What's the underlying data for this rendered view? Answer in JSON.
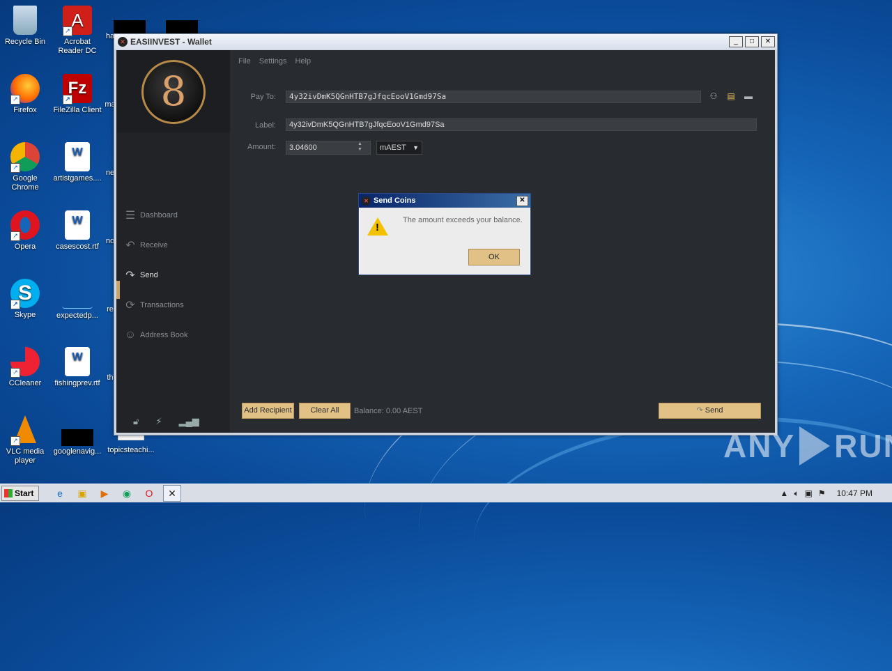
{
  "desktop": {
    "icons": [
      {
        "label": "Recycle Bin"
      },
      {
        "label": "Acrobat Reader DC"
      },
      {
        "label": "ha"
      },
      {
        "label": "Firefox"
      },
      {
        "label": "FileZilla Client"
      },
      {
        "label": "ma"
      },
      {
        "label": "Google Chrome"
      },
      {
        "label": "artistgames...."
      },
      {
        "label": "ne"
      },
      {
        "label": "Opera"
      },
      {
        "label": "casescost.rtf"
      },
      {
        "label": "no"
      },
      {
        "label": "Skype"
      },
      {
        "label": "expectedp..."
      },
      {
        "label": "re"
      },
      {
        "label": "CCleaner"
      },
      {
        "label": "fishingprev.rtf"
      },
      {
        "label": "th"
      },
      {
        "label": "VLC media player"
      },
      {
        "label": "googlenavig..."
      },
      {
        "label": "topicsteachi..."
      }
    ]
  },
  "window": {
    "title": "EASIINVEST - Wallet",
    "menu": [
      "File",
      "Settings",
      "Help"
    ],
    "nav": [
      {
        "label": "Dashboard",
        "icon": "stack-icon"
      },
      {
        "label": "Receive",
        "icon": "reply-icon"
      },
      {
        "label": "Send",
        "icon": "forward-icon"
      },
      {
        "label": "Transactions",
        "icon": "sync-icon"
      },
      {
        "label": "Address Book",
        "icon": "person-icon"
      }
    ],
    "form": {
      "pay_to_label": "Pay To:",
      "pay_to_value": "4y32ivDmK5QGnHTB7gJfqcEooV1Gmd97Sa",
      "label_label": "Label:",
      "label_value": "4y32ivDmK5QGnHTB7gJfqcEooV1Gmd97Sa",
      "amount_label": "Amount:",
      "amount_value": "3.04600",
      "unit": "mAEST"
    },
    "buttons": {
      "add_recipient": "Add Recipient",
      "clear_all": "Clear All",
      "send": "Send"
    },
    "balance": "Balance: 0.00 AEST"
  },
  "dialog": {
    "title": "Send Coins",
    "message": "The amount exceeds your balance.",
    "ok": "OK"
  },
  "taskbar": {
    "start": "Start",
    "time": "10:47 PM"
  },
  "watermark": {
    "text_left": "ANY",
    "text_right": "RUN"
  }
}
